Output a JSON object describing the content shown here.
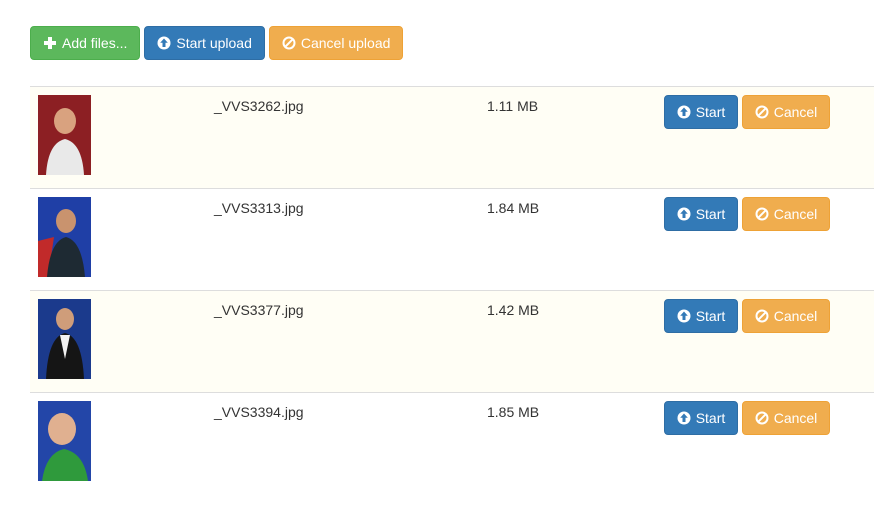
{
  "toolbar": {
    "add_label": "Add files...",
    "start_label": "Start upload",
    "cancel_label": "Cancel upload"
  },
  "files": [
    {
      "name": "_VVS3262.jpg",
      "size": "1.11 MB",
      "start_label": "Start",
      "cancel_label": "Cancel",
      "thumb_bg": "#8c1f23",
      "thumb_shirt": "#e9e9e9"
    },
    {
      "name": "_VVS3313.jpg",
      "size": "1.84 MB",
      "start_label": "Start",
      "cancel_label": "Cancel",
      "thumb_bg": "#1f3fa6",
      "thumb_shirt": "#1e2a33"
    },
    {
      "name": "_VVS3377.jpg",
      "size": "1.42 MB",
      "start_label": "Start",
      "cancel_label": "Cancel",
      "thumb_bg": "#1b3a8c",
      "thumb_shirt": "#151515"
    },
    {
      "name": "_VVS3394.jpg",
      "size": "1.85 MB",
      "start_label": "Start",
      "cancel_label": "Cancel",
      "thumb_bg": "#2346a8",
      "thumb_shirt": "#2f9a3c"
    }
  ],
  "colors": {
    "success": "#5cb85c",
    "primary": "#337ab7",
    "warning": "#f0ad4e",
    "row_stripe": "#fffef5"
  },
  "icons": {
    "add": "plus-icon",
    "start": "circle-arrow-up-icon",
    "cancel": "ban-circle-icon"
  }
}
